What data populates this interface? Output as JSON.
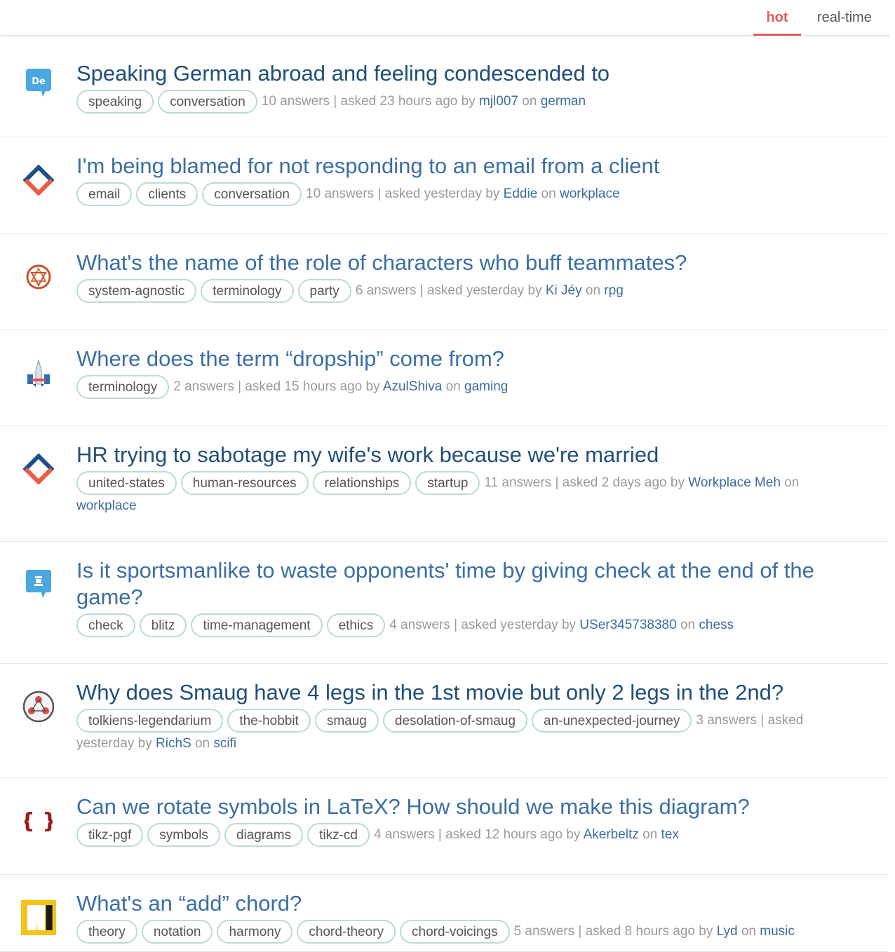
{
  "tabs": {
    "hot": "hot",
    "realtime": "real-time"
  },
  "questions": [
    {
      "title": "Speaking German abroad and feeling condescended to",
      "tags": [
        "speaking",
        "conversation"
      ],
      "answers": "10 answers",
      "asked": "asked 23 hours ago by",
      "user": "mjl007",
      "on": "on",
      "site": "german",
      "icon": "german-icon"
    },
    {
      "title": "I'm being blamed for not responding to an email from a client",
      "tags": [
        "email",
        "clients",
        "conversation"
      ],
      "answers": "10 answers",
      "asked": "asked yesterday by",
      "user": "Eddie",
      "on": "on",
      "site": "workplace",
      "icon": "workplace-icon"
    },
    {
      "title": "What's the name of the role of characters who buff teammates?",
      "tags": [
        "system-agnostic",
        "terminology",
        "party"
      ],
      "answers": "6 answers",
      "asked": "asked yesterday by",
      "user": "Ki Jéy",
      "on": "on",
      "site": "rpg",
      "icon": "rpg-icon"
    },
    {
      "title": "Where does the term “dropship” come from?",
      "tags": [
        "terminology"
      ],
      "answers": "2 answers",
      "asked": "asked 15 hours ago by",
      "user": "AzulShiva",
      "on": "on",
      "site": "gaming",
      "icon": "gaming-icon"
    },
    {
      "title": "HR trying to sabotage my wife's work because we're married",
      "tags": [
        "united-states",
        "human-resources",
        "relationships",
        "startup"
      ],
      "answers": "11 answers",
      "asked": "asked 2 days ago by",
      "user": "Workplace Meh",
      "on": "on",
      "site": "workplace",
      "icon": "workplace-icon"
    },
    {
      "title": "Is it sportsmanlike to waste opponents' time by giving check at the end of the game?",
      "tags": [
        "check",
        "blitz",
        "time-management",
        "ethics"
      ],
      "answers": "4 answers",
      "asked": "asked yesterday by",
      "user": "USer345738380",
      "on": "on",
      "site": "chess",
      "icon": "chess-icon"
    },
    {
      "title": "Why does Smaug have 4 legs in the 1st movie but only 2 legs in the 2nd?",
      "tags": [
        "tolkiens-legendarium",
        "the-hobbit",
        "smaug",
        "desolation-of-smaug",
        "an-unexpected-journey"
      ],
      "answers": "3 answers",
      "asked": "asked yesterday by",
      "user": "RichS",
      "on": "on",
      "site": "scifi",
      "icon": "scifi-icon"
    },
    {
      "title": "Can we rotate symbols in LaTeX? How should we make this diagram?",
      "tags": [
        "tikz-pgf",
        "symbols",
        "diagrams",
        "tikz-cd"
      ],
      "answers": "4 answers",
      "asked": "asked 12 hours ago by",
      "user": "Akerbeltz",
      "on": "on",
      "site": "tex",
      "icon": "tex-icon"
    },
    {
      "title": "What's an “add” chord?",
      "tags": [
        "theory",
        "notation",
        "harmony",
        "chord-theory",
        "chord-voicings"
      ],
      "answers": "5 answers",
      "asked": "asked 8 hours ago by",
      "user": "Lyd",
      "on": "on",
      "site": "music",
      "icon": "music-icon"
    }
  ]
}
